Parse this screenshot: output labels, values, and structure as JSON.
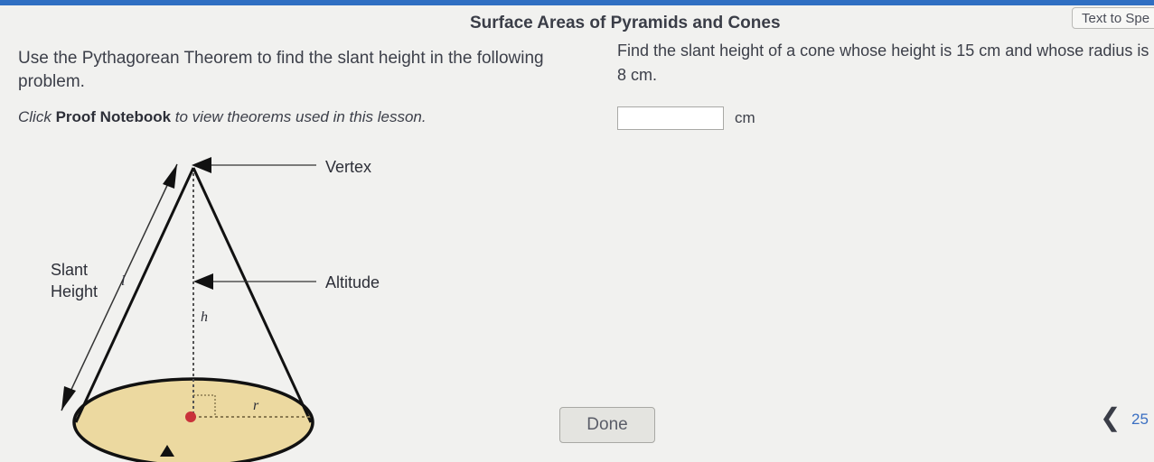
{
  "header": {
    "title": "Surface Areas of Pyramids and Cones",
    "text_to_speech_label": "Text to Spe"
  },
  "left_panel": {
    "instructions": "Use the Pythagorean Theorem to find the slant height in the following problem.",
    "proof_note_pre": "Click ",
    "proof_note_link": "Proof Notebook",
    "proof_note_post": " to view theorems used in this lesson.",
    "diagram": {
      "vertex_label": "Vertex",
      "altitude_label": "Altitude",
      "slant_label_line1": "Slant",
      "slant_label_line2": "Height",
      "slant_var": "l",
      "height_var": "h",
      "radius_var": "r"
    }
  },
  "question": {
    "text": "Find the slant height of a cone whose height is 15 cm and whose radius is 8 cm.",
    "answer_value": "",
    "unit": "cm"
  },
  "footer": {
    "done_label": "Done",
    "prev_icon": "chevron-left-icon",
    "page_number": "25"
  },
  "colors": {
    "accent_bar": "#2f6fc2",
    "cone_base_fill": "#ecd9a0",
    "page_number": "#3a6fc2"
  }
}
